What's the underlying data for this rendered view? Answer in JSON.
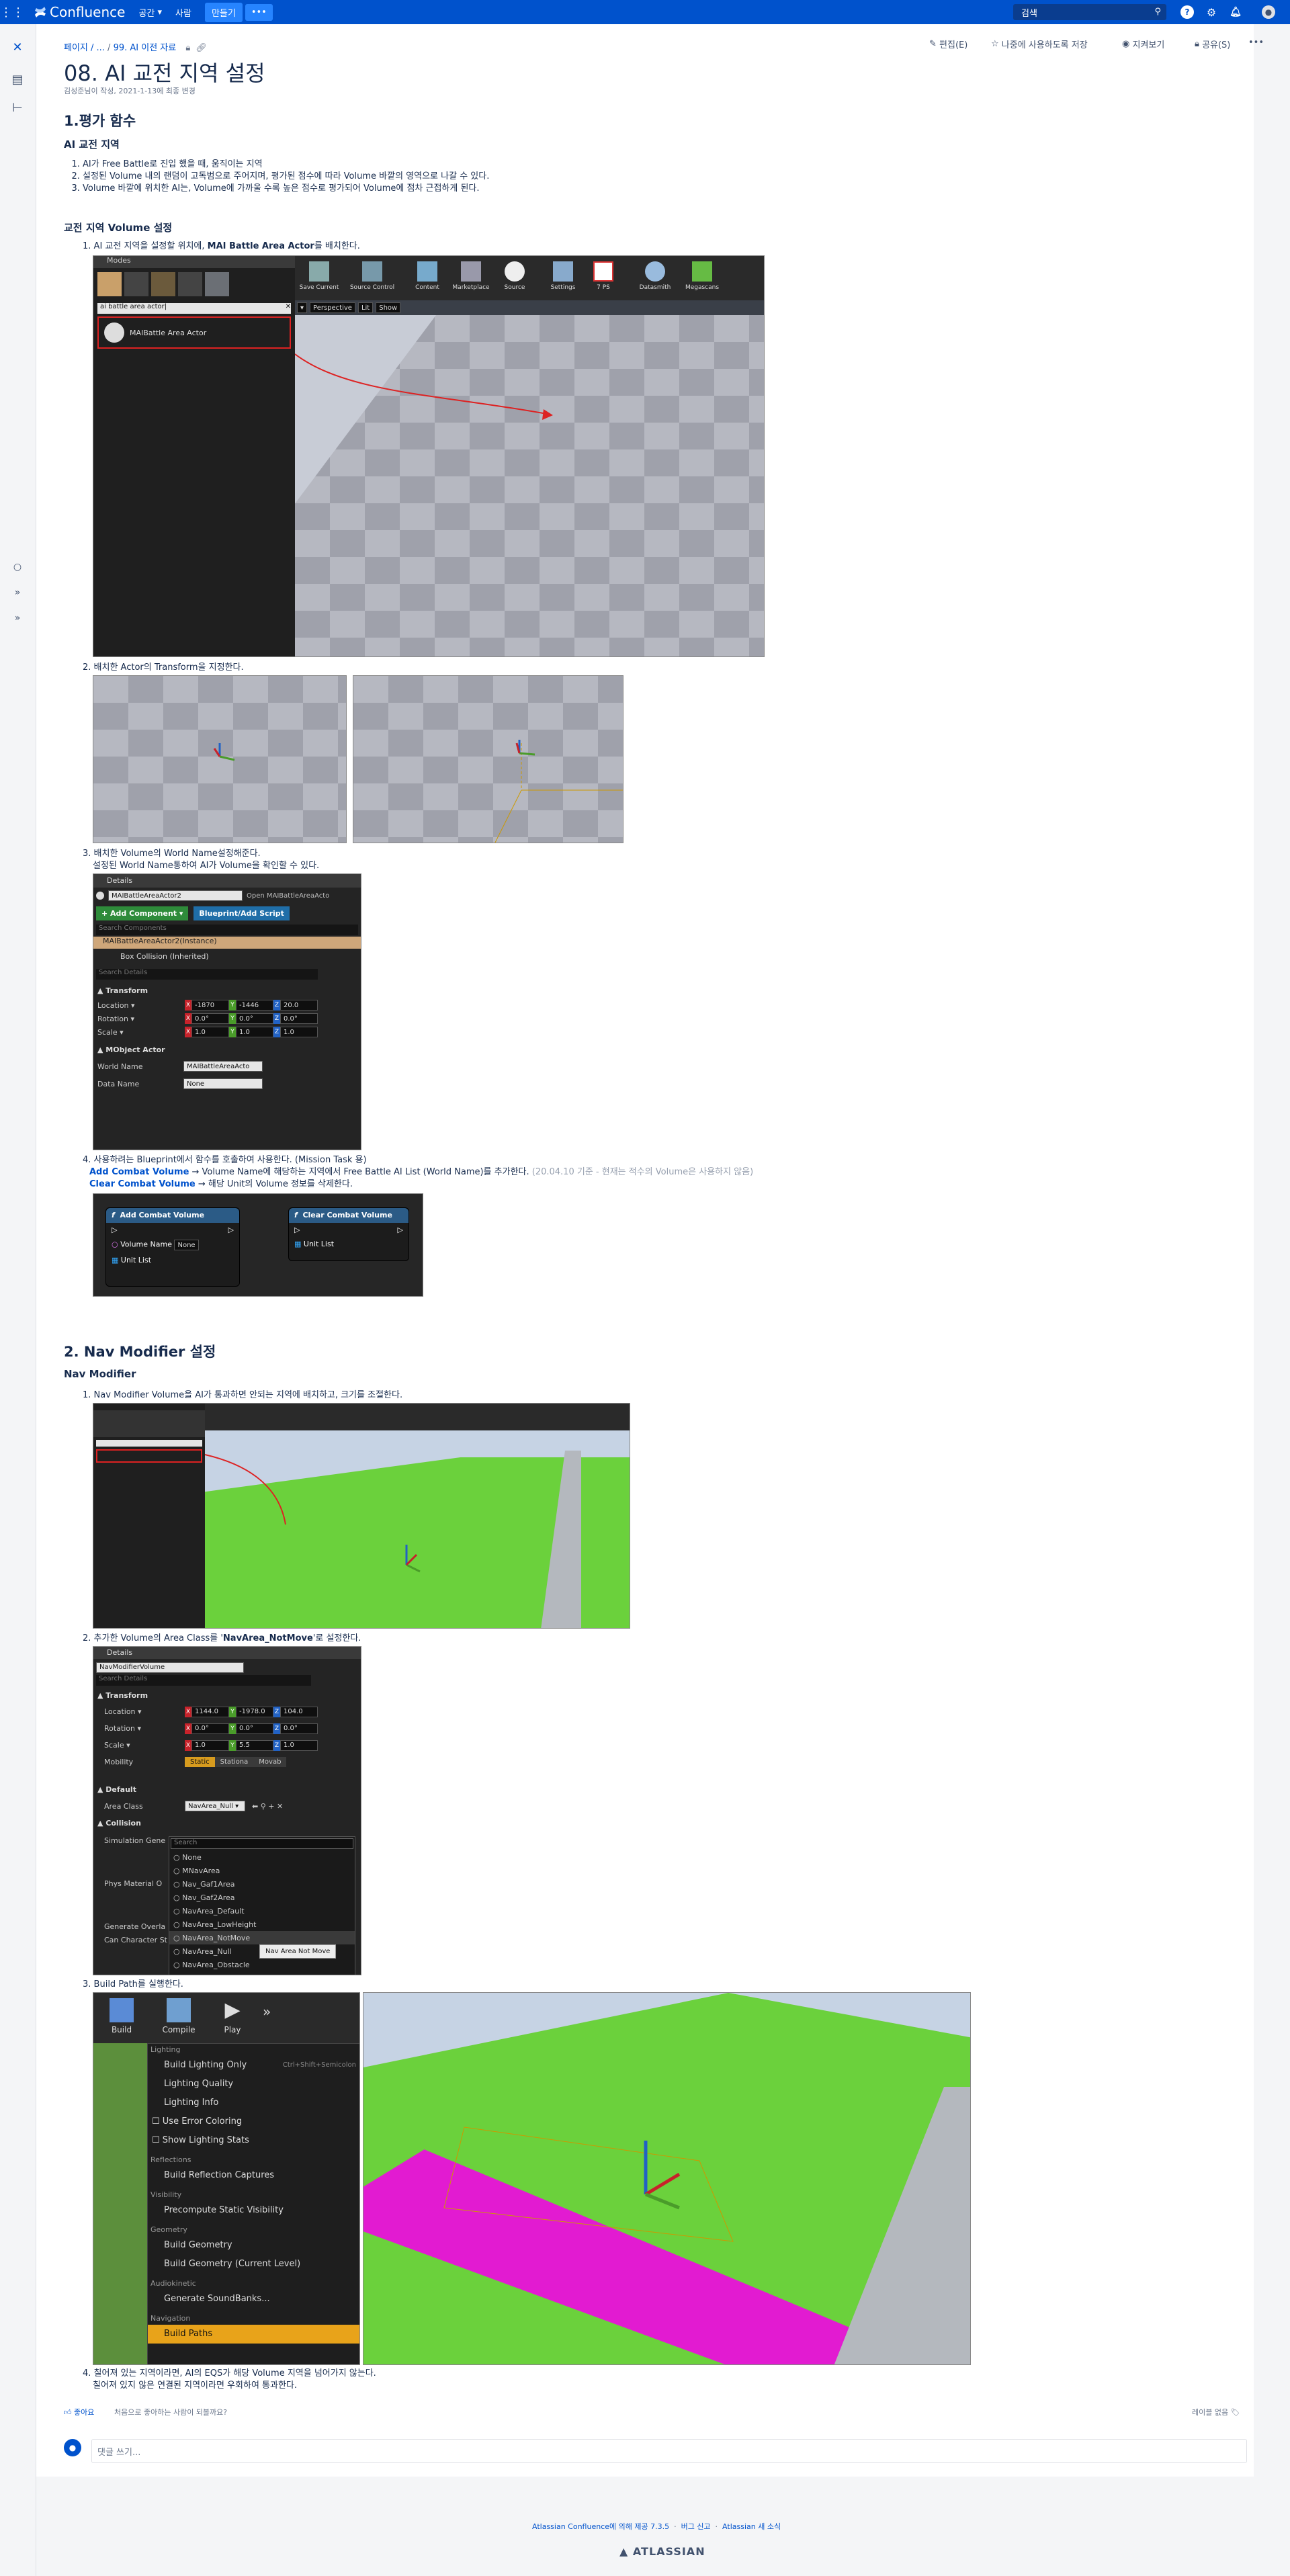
{
  "topbar": {
    "app_name": "Confluence",
    "nav": [
      "공간",
      "사람"
    ],
    "create": "만들기",
    "more": "•••",
    "search_placeholder": "검색"
  },
  "breadcrumb": {
    "root": "페이지 / ...",
    "sep": " / ",
    "parent": "99. AI 이전 자료"
  },
  "page": {
    "title": "08. AI 교전 지역 설정",
    "meta": "김성준님이 작성, 2021-1-13에 최종 변경"
  },
  "actions": {
    "edit": "편집(E)",
    "save_later": "나중에 사용하도록 저장",
    "watch": "지켜보기",
    "share": "공유(S)",
    "more": "•••"
  },
  "section1": {
    "heading": "1.평가 함수",
    "sub1": "AI 교전 지역",
    "items": [
      "AI가 Free Battle로 진입 했을 때, 움직이는 지역",
      "설정된 Volume 내의 랜덤이 고독범으로 주어지며, 평가된 점수에 따라 Volume 바깥의 영역으로 나갈 수 있다.",
      "Volume 바깥에 위치한 AI는, Volume에 가까울 수록 높은 점수로 평가되어 Volume에 점차 근접하게 된다."
    ],
    "sub2": "교전 지역 Volume 설정",
    "step1_prefix": "AI 교전 지역을 설정할 위치에, ",
    "step1_bold": "MAI Battle Area Actor",
    "step1_suffix": "를 배치한다.",
    "step2": "배치한 Actor의 Transform을 지정한다.",
    "step3_a": "배치한 Volume의 World Name설정해준다.",
    "step3_b": "설정된 World Name통하여 AI가 Volume을 확인할 수 있다.",
    "step4_a": "사용하려는 Blueprint에서 함수를 호출하여 사용한다. (Mission Task 용)",
    "step4_b_bold": "Add Combat Volume",
    "step4_b": " → Volume Name에 해당하는 지역에서 Free Battle AI List (World Name)를 추가한다.",
    "step4_b_note": "(20.04.10 기준 - 현재는 적수의 Volume은 사용하지 않음)",
    "step4_c_bold": "Clear Combat Volume",
    "step4_c": " → 해당 Unit의 Volume 정보를 삭제한다."
  },
  "ue_shot1": {
    "modes": "Modes",
    "search": "ai battle area actor|",
    "result": "MAIBattle Area Actor",
    "toolbar": [
      "Save Current",
      "Source Control",
      "Content",
      "Marketplace",
      "Source",
      "Settings",
      "7 PS",
      "Datasmith",
      "Megascans"
    ],
    "vp_buttons": [
      "Perspective",
      "Lit",
      "Show"
    ]
  },
  "details1": {
    "tab": "Details",
    "name": "MAIBattleAreaActor2",
    "open": "Open MAIBattleAreaActo",
    "add_component": "+ Add Component ▾",
    "blueprint": "Blueprint/Add Script",
    "search_components": "Search Components",
    "instance": "MAIBattleAreaActor2(Instance)",
    "box": "Box Collision (Inherited)",
    "search_details": "Search Details",
    "transform": "Transform",
    "location": "Location ▾",
    "rotation": "Rotation ▾",
    "scale": "Scale ▾",
    "loc": [
      "-1870",
      "-1446",
      "20.0"
    ],
    "rot": [
      "0.0°",
      "0.0°",
      "0.0°"
    ],
    "scl": [
      "1.0",
      "1.0",
      "1.0"
    ],
    "mobject": "MObject Actor",
    "world_name_label": "World Name",
    "world_name": "MAIBattleAreaActo",
    "data_name_label": "Data Name",
    "data_name": "None"
  },
  "bp": {
    "add": "Add Combat Volume",
    "clear": "Clear Combat Volume",
    "volume_name": "Volume Name",
    "none": "None",
    "unit_list": "Unit List"
  },
  "section2": {
    "heading": "2. Nav Modifier 설정",
    "sub": "Nav Modifier",
    "step1": "Nav Modifier Volume을 AI가 통과하면 안되는 지역에 배치하고, 크기를 조절한다.",
    "step2_prefix": "추가한 Volume의 Area Class를 '",
    "step2_bold": "NavArea_NotMove",
    "step2_suffix": "'로 설정한다.",
    "step3": "Build Path를 실행한다.",
    "step4_a": "칠어져 있는 지역이라면, AI의 EQS가 해당 Volume 지역을 넘어가지 않는다.",
    "step4_b": "칠어져 있지 않은 연결된 지역이라면 우회하여 통과한다."
  },
  "details2": {
    "tab": "Details",
    "name": "NavModifierVolume",
    "search": "Search Details",
    "transform": "Transform",
    "location": "Location ▾",
    "rotation": "Rotation ▾",
    "scale": "Scale ▾",
    "mobility": "Mobility",
    "loc": [
      "1144.0",
      "-1978.0",
      "104.0"
    ],
    "rot": [
      "0.0°",
      "0.0°",
      "0.0°"
    ],
    "scl": [
      "1.0",
      "5.5",
      "1.0"
    ],
    "mobility_opts": [
      "Static",
      "Stationa",
      "Movab"
    ],
    "default": "Default",
    "area_class_label": "Area Class",
    "area_class": "NavArea_Null ▾",
    "collision": "Collision",
    "sim_gen": "Simulation Gene",
    "phys_mat": "Phys Material O",
    "gen_overlap": "Generate Overla",
    "can_char": "Can Character St",
    "dropdown_search": "Search",
    "options": [
      "None",
      "MNavArea",
      "Nav_Gaf1Area",
      "Nav_Gaf2Area",
      "NavArea_Default",
      "NavArea_LowHeight",
      "NavArea_NotMove",
      "NavArea_Null",
      "NavArea_Obstacle"
    ],
    "tooltip": "Nav Area Not Move"
  },
  "build_menu": {
    "buttons": [
      "Build",
      "Compile",
      "Play"
    ],
    "groups": [
      {
        "head": "Lighting",
        "items": [
          "Build Lighting Only",
          "Lighting Quality",
          "Lighting Info",
          "Use Error Coloring",
          "Show Lighting Stats"
        ]
      },
      {
        "head": "Reflections",
        "items": [
          "Build Reflection Captures"
        ]
      },
      {
        "head": "Visibility",
        "items": [
          "Precompute Static Visibility"
        ]
      },
      {
        "head": "Geometry",
        "items": [
          "Build Geometry",
          "Build Geometry (Current Level)"
        ]
      },
      {
        "head": "Audiokinetic",
        "items": [
          "Generate SoundBanks..."
        ]
      },
      {
        "head": "Navigation",
        "items": [
          "Build Paths"
        ]
      }
    ],
    "shortcut": "Ctrl+Shift+Semicolon"
  },
  "bottom": {
    "like": "좋아요",
    "like_prompt": "처음으로 좋아하는 사람이 되볼까요?",
    "labels": "레이블 없음",
    "comment": "댓글 쓰기..."
  },
  "footer": {
    "powered": "Atlassian Confluence에 의해 제공 7.3.5",
    "report": "버그 신고",
    "news": "Atlassian 새 소식",
    "brand": "ATLASSIAN"
  },
  "colors": {
    "brand": "#0052cc",
    "nav_green": "#6bd13c",
    "nav_magenta": "#e21bd1"
  }
}
